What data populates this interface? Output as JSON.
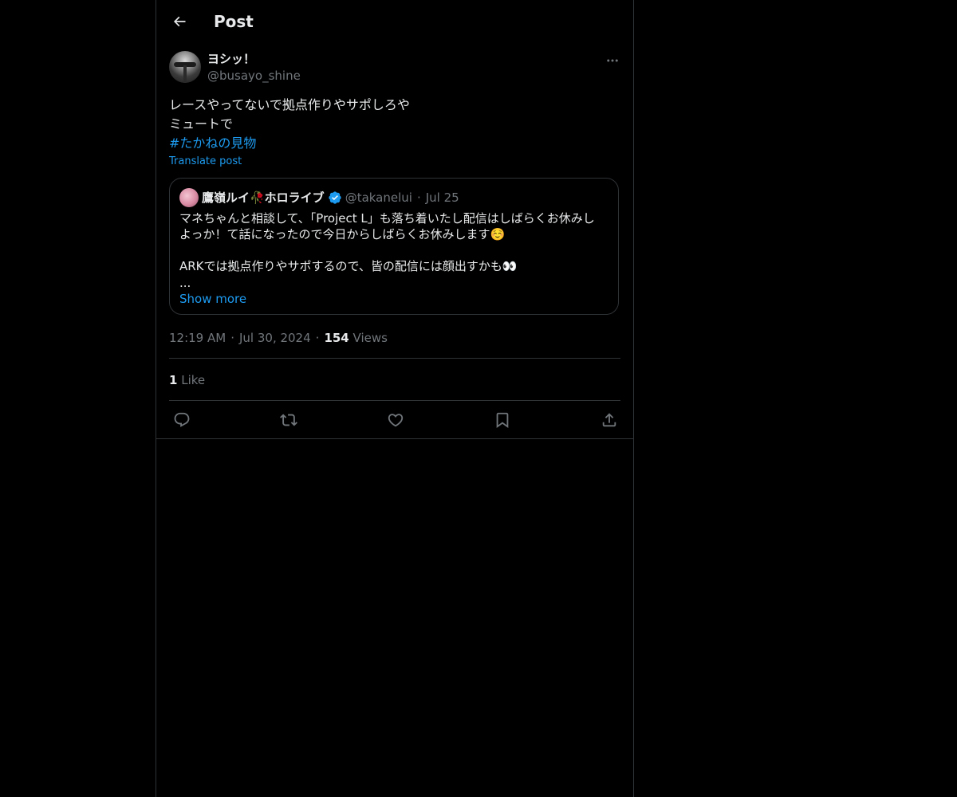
{
  "header": {
    "title": "Post"
  },
  "post": {
    "display_name": "ヨシッ！",
    "handle": "@busayo_shine",
    "text_lines": [
      "レースやってないで拠点作りやサポしろや",
      "ミュートで"
    ],
    "hashtag": "#たかねの見物",
    "translate_label": "Translate post",
    "time": "12:19 AM",
    "date": "Jul 30, 2024",
    "views_count": "154",
    "views_label": "Views",
    "likes_count": "1",
    "likes_label": "Like"
  },
  "quote": {
    "display_name": "鷹嶺ルイ🥀ホロライブ",
    "verified": true,
    "handle": "@takanelui",
    "date": "Jul 25",
    "lines": [
      "マネちゃんと相談して、「Project L」も落ち着いたし配信はしばらくお休みし",
      "よっか！て話になったので今日からしばらくお休みします☺️",
      "",
      "ARKでは拠点作りやサポするので、皆の配信には顔出すかも👀",
      "..."
    ],
    "show_more_label": "Show more"
  },
  "icons": {
    "back": "arrow-left-icon",
    "more": "more-horizontal-icon",
    "verified": "verified-badge-icon",
    "reply": "reply-icon",
    "repost": "repost-icon",
    "like": "heart-icon",
    "bookmark": "bookmark-icon",
    "share": "share-icon"
  },
  "colors": {
    "background": "#000000",
    "text": "#e7e9ea",
    "secondary_text": "#71767b",
    "accent": "#1d9bf0",
    "border": "#2f3336"
  }
}
